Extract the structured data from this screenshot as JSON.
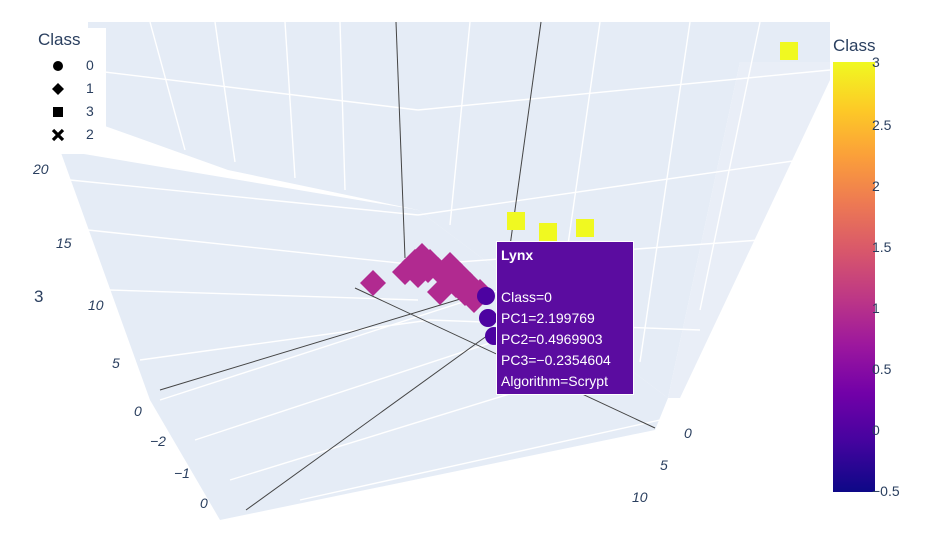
{
  "chart_data": {
    "type": "scatter",
    "axes": {
      "x_ticks": [
        "−2",
        "−1",
        "0"
      ],
      "y_ticks": [
        "0",
        "5",
        "10"
      ],
      "z_ticks": [
        "0",
        "5",
        "10",
        "15",
        "20"
      ],
      "z_title": "3"
    },
    "legend": {
      "title": "Class",
      "items": [
        {
          "label": "0",
          "symbol": "circle-icon"
        },
        {
          "label": "1",
          "symbol": "diamond-icon"
        },
        {
          "label": "3",
          "symbol": "square-icon"
        },
        {
          "label": "2",
          "symbol": "x-icon"
        }
      ]
    },
    "colorbar": {
      "title": "Class",
      "ticks": [
        "3",
        "2.5",
        "2",
        "1.5",
        "1",
        "0.5",
        "0",
        "−0.5"
      ],
      "range": [
        -0.5,
        3
      ]
    },
    "series": [
      {
        "class": 1,
        "color": "#b12a90"
      },
      {
        "class": 3,
        "color": "#f0f921"
      },
      {
        "class": 0,
        "color": "#4c02a1"
      }
    ],
    "hover": {
      "title": "Lynx",
      "lines": [
        "Class=0",
        "PC1=2.199769",
        "PC2=0.4969903",
        "PC3=−0.2354604",
        "Algorithm=Scrypt"
      ]
    }
  }
}
